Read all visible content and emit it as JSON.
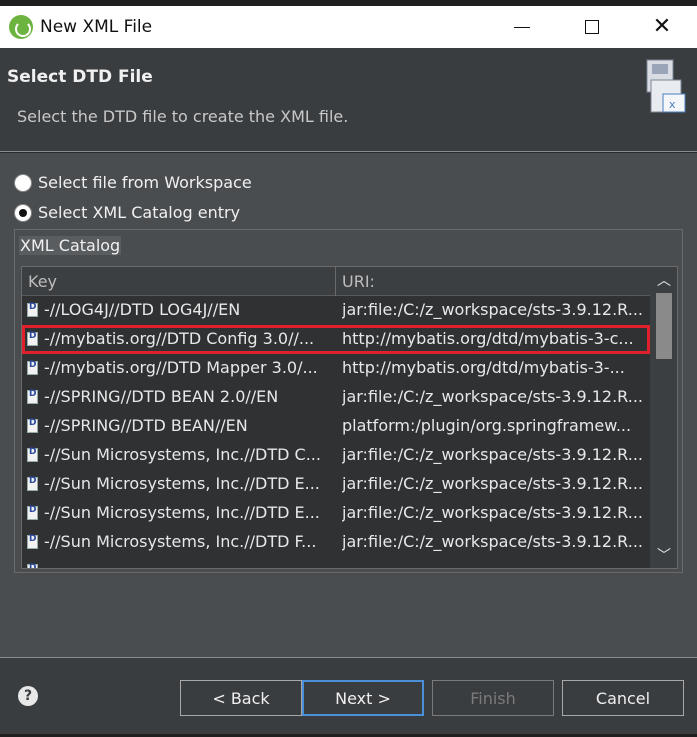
{
  "window": {
    "title": "New XML File",
    "icon": "spring-leaf-icon"
  },
  "banner": {
    "title": "Select DTD File",
    "message": "Select the DTD file to create the XML file.",
    "icon": "xml-file-wizard-icon"
  },
  "options": [
    {
      "label": "Select file from Workspace",
      "selected": false
    },
    {
      "label": "Select XML Catalog entry",
      "selected": true
    }
  ],
  "catalog": {
    "group_label": "XML Catalog",
    "columns": [
      "Key",
      "URI:"
    ],
    "rows": [
      {
        "key": "-//LOG4J//DTD LOG4J//EN",
        "uri": "jar:file:/C:/z_workspace/sts-3.9.12.R..."
      },
      {
        "key": "-//mybatis.org//DTD Config 3.0//...",
        "uri": "http://mybatis.org/dtd/mybatis-3-c...",
        "selected": true
      },
      {
        "key": "-//mybatis.org//DTD Mapper 3.0/...",
        "uri": "http://mybatis.org/dtd/mybatis-3-..."
      },
      {
        "key": "-//SPRING//DTD BEAN 2.0//EN",
        "uri": "jar:file:/C:/z_workspace/sts-3.9.12.R..."
      },
      {
        "key": "-//SPRING//DTD BEAN//EN",
        "uri": "platform:/plugin/org.springframew..."
      },
      {
        "key": "-//Sun Microsystems, Inc.//DTD C...",
        "uri": "jar:file:/C:/z_workspace/sts-3.9.12.R..."
      },
      {
        "key": "-//Sun Microsystems, Inc.//DTD E...",
        "uri": "jar:file:/C:/z_workspace/sts-3.9.12.R..."
      },
      {
        "key": "-//Sun Microsystems, Inc.//DTD E...",
        "uri": "jar:file:/C:/z_workspace/sts-3.9.12.R..."
      },
      {
        "key": "-//Sun Microsystems, Inc.//DTD F...",
        "uri": "jar:file:/C:/z_workspace/sts-3.9.12.R..."
      }
    ]
  },
  "footer": {
    "help": "?",
    "back": "< Back",
    "next": "Next >",
    "finish": "Finish",
    "cancel": "Cancel"
  },
  "colors": {
    "selection_outline": "#e0202a",
    "primary_button_border": "#4a90d9"
  }
}
